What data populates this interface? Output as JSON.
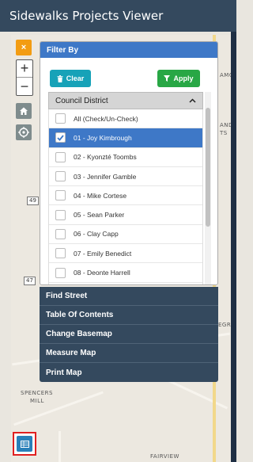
{
  "app": {
    "title": "Sidewalks Projects Viewer"
  },
  "map": {
    "labels": [
      {
        "text": "AMO"
      },
      {
        "text": "AND"
      },
      {
        "text": "TS"
      },
      {
        "text": "EGRA"
      },
      {
        "text": "SPENCERS"
      },
      {
        "text": "MILL"
      },
      {
        "text": "FAIRVIEW"
      }
    ],
    "shields": [
      "49",
      "47"
    ],
    "controls": {
      "close_label": "×",
      "zoom_in_label": "+",
      "zoom_out_label": "−"
    }
  },
  "filter": {
    "header": "Filter By",
    "clear_label": "Clear",
    "apply_label": "Apply",
    "district_header": "Council District",
    "items": [
      {
        "label": "All (Check/Un-Check)",
        "checked": false
      },
      {
        "label": "01 - Joy Kimbrough",
        "checked": true
      },
      {
        "label": "02 - Kyonzté Toombs",
        "checked": false
      },
      {
        "label": "03 - Jennifer Gamble",
        "checked": false
      },
      {
        "label": "04 - Mike Cortese",
        "checked": false
      },
      {
        "label": "05 - Sean Parker",
        "checked": false
      },
      {
        "label": "06 - Clay Capp",
        "checked": false
      },
      {
        "label": "07 - Emily Benedict",
        "checked": false
      },
      {
        "label": "08 - Deonte Harrell",
        "checked": false
      }
    ]
  },
  "menu": {
    "items": [
      "Find Street",
      "Table Of Contents",
      "Change Basemap",
      "Measure Map",
      "Print Map"
    ]
  },
  "colors": {
    "title_bar": "#34495e",
    "panel_header": "#3e78c7",
    "clear": "#17a2b8",
    "apply": "#28a745",
    "close": "#f39c12"
  }
}
